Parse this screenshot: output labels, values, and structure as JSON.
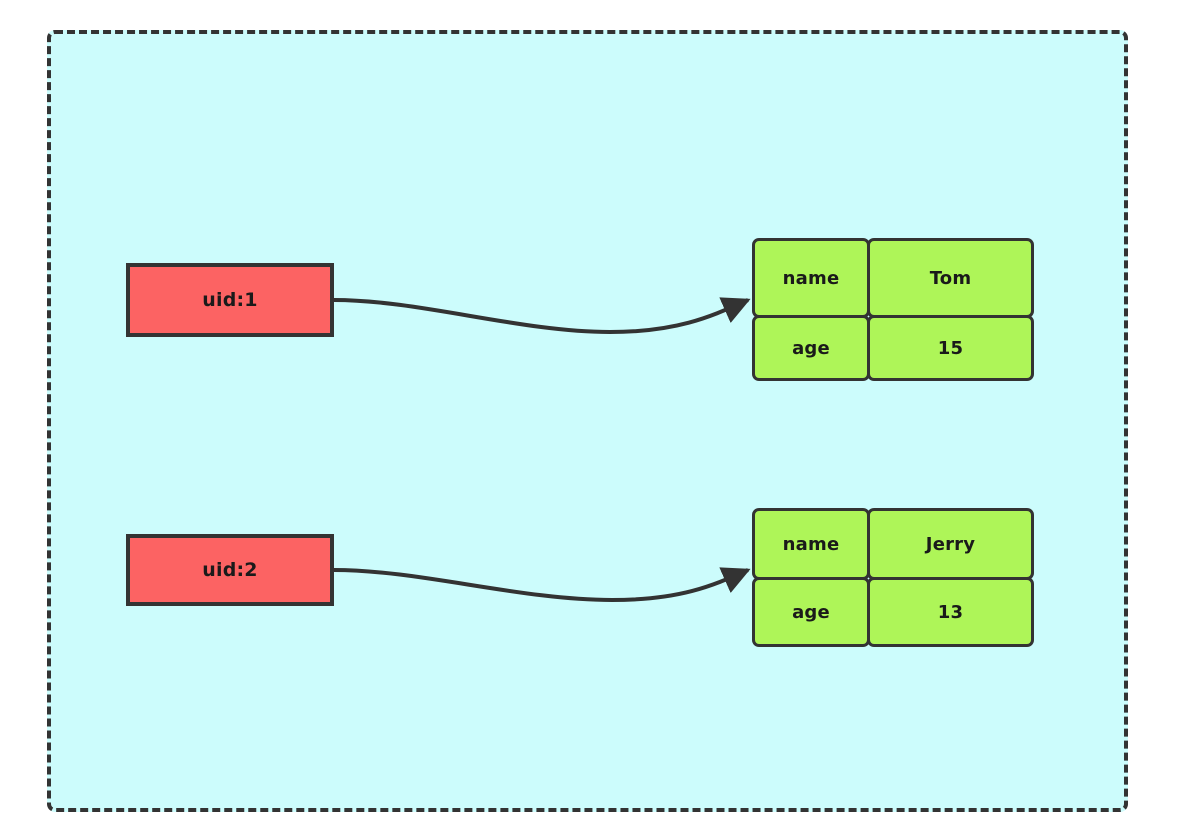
{
  "diagram": {
    "type": "entity-record-mapping",
    "title": "",
    "background_color": "#CCFCFC",
    "border_color": "#333333",
    "node_colors": {
      "uid_node": "#FC6363",
      "record_cell": "#AEF558",
      "edge": "#333333"
    }
  },
  "uid_nodes": [
    {
      "id": "uid-1",
      "label": "uid:1"
    },
    {
      "id": "uid-2",
      "label": "uid:2"
    }
  ],
  "record_tables": [
    {
      "id": "record-1",
      "rows": [
        {
          "key": "name",
          "value": "Tom"
        },
        {
          "key": "age",
          "value": "15"
        }
      ]
    },
    {
      "id": "record-2",
      "rows": [
        {
          "key": "name",
          "value": "Jerry"
        },
        {
          "key": "age",
          "value": "13"
        }
      ]
    }
  ],
  "edges": [
    {
      "id": "edge-1",
      "from": "uid-1",
      "to": "record-1",
      "arrow": "arrowhead"
    },
    {
      "id": "edge-2",
      "from": "uid-2",
      "to": "record-2",
      "arrow": "arrowhead"
    }
  ]
}
